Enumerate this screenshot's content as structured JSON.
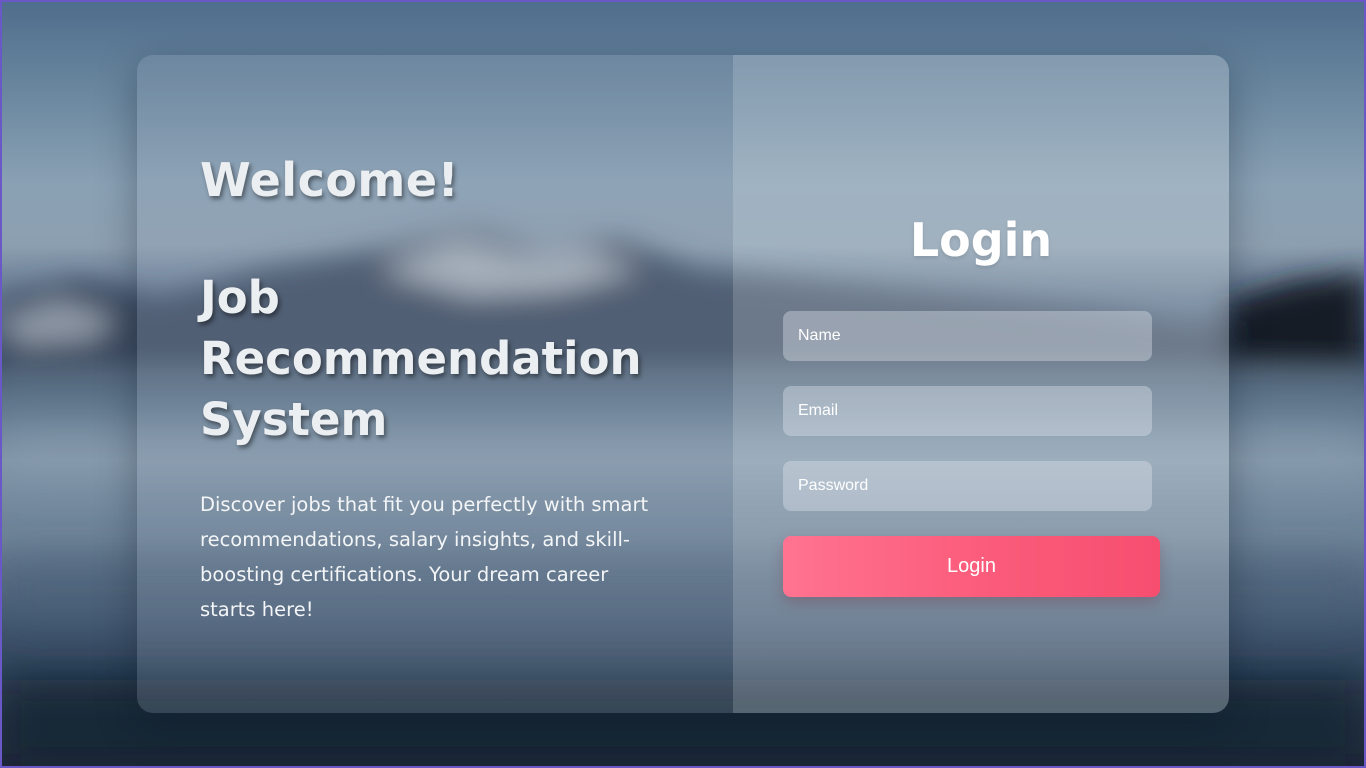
{
  "welcome": {
    "greeting": "Welcome!",
    "title": "Job Recommendation System",
    "description": "Discover jobs that fit you perfectly with smart recommendations, salary insights, and skill-boosting certifications. Your dream career starts here!"
  },
  "login": {
    "title": "Login",
    "name_placeholder": "Name",
    "email_placeholder": "Email",
    "password_placeholder": "Password",
    "button_label": "Login"
  },
  "colors": {
    "button_gradient_start": "#ff7391",
    "button_gradient_end": "#f74e70",
    "frame_border": "#6a58c6",
    "text": "#ffffff"
  }
}
